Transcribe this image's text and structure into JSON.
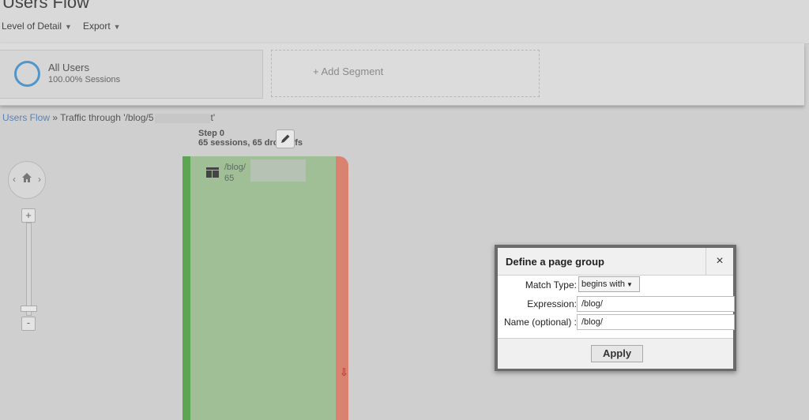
{
  "page": {
    "title": "Users Flow"
  },
  "menu": {
    "items": [
      {
        "label": "Level of Detail"
      },
      {
        "label": "Export"
      }
    ]
  },
  "segments": {
    "active": {
      "name": "All Users",
      "detail": "100.00% Sessions"
    },
    "add_label": "+ Add Segment"
  },
  "breadcrumb": {
    "root": "Users Flow",
    "separator": "»",
    "traffic_prefix": "Traffic through '/blog/5",
    "traffic_suffix": "t'"
  },
  "flow": {
    "step_title": "Step 0",
    "step_summary": "65 sessions, 65 drop-offs",
    "node_name": "/blog/",
    "node_count": "65",
    "drop_arrow": "⇩"
  },
  "controls": {
    "zoom_in": "+",
    "zoom_out": "-",
    "nav_left": "‹",
    "nav_right": "›"
  },
  "dialog": {
    "title": "Define a page group",
    "close": "×",
    "match_type_label": "Match Type:",
    "match_type_value": "begins with",
    "expression_label": "Expression:",
    "expression_value": "/blog/",
    "name_label": "Name (optional) :",
    "name_value": "/blog/",
    "apply_label": "Apply"
  },
  "colors": {
    "segment_ring": "#5296c9",
    "flow_fill": "#a0bf96",
    "flow_edge": "#5ba553",
    "dropoff": "#d9826f",
    "link": "#5a84b3"
  }
}
